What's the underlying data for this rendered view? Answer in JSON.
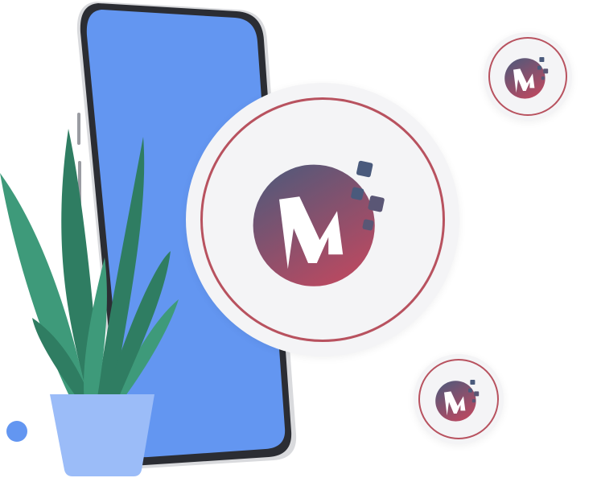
{
  "brand": {
    "logo_name": "m-pixel-logo",
    "colors": {
      "ring": "#b8525f",
      "logo_top": "#4a5a7c",
      "logo_bottom": "#b54a62",
      "badge_bg": "#f4f4f6"
    }
  },
  "phone": {
    "screen_color": "#6396f1",
    "frame_color": "#2b2d33"
  },
  "plant": {
    "pot_color": "#9bbcf8",
    "leaf_dark": "#2f7d62",
    "leaf_light": "#3e9a7a"
  },
  "accent_dot_color": "#6396f1"
}
